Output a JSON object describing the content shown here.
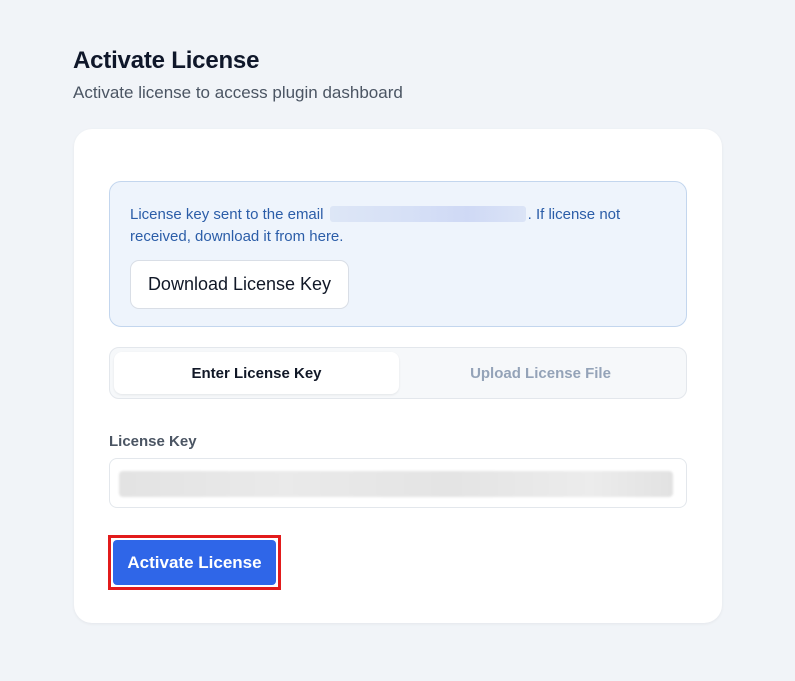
{
  "header": {
    "title": "Activate License",
    "subtitle": "Activate license to access plugin dashboard"
  },
  "info": {
    "text_before": "License key sent to the email",
    "text_after": ". If license not received, download it from here.",
    "download_button": "Download License Key"
  },
  "tabs": [
    {
      "label": "Enter License Key",
      "active": true
    },
    {
      "label": "Upload License File",
      "active": false
    }
  ],
  "form": {
    "license_key_label": "License Key",
    "license_key_value": "",
    "submit_button": "Activate License"
  },
  "colors": {
    "page_background": "#f1f4f8",
    "info_text": "#2b5da8",
    "primary_button": "#2f66e8",
    "highlight_outline": "#e21b1b"
  }
}
